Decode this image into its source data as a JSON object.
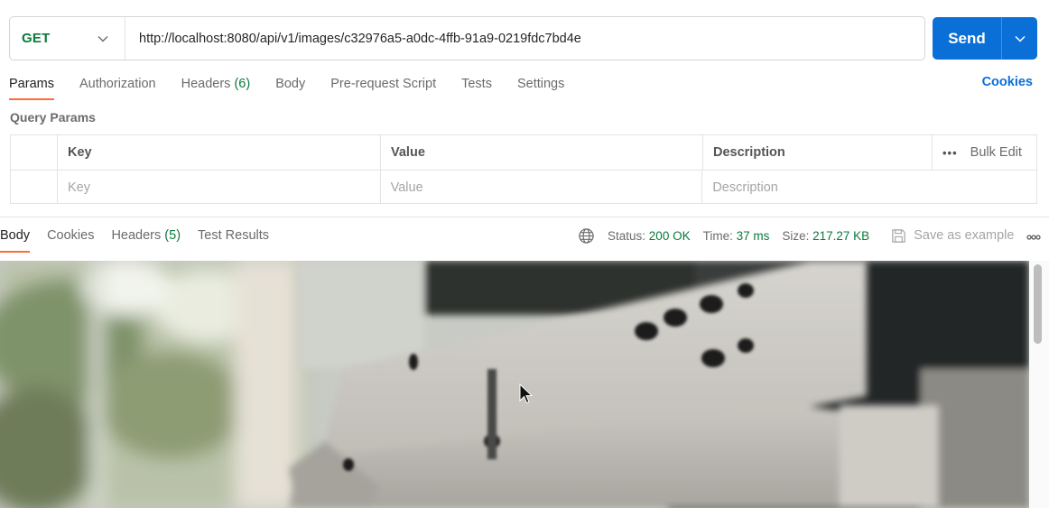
{
  "request": {
    "method": "GET",
    "url": "http://localhost:8080/api/v1/images/c32976a5-a0dc-4ffb-91a9-0219fdc7bd4e",
    "send_label": "Send"
  },
  "request_tabs": {
    "params": "Params",
    "authorization": "Authorization",
    "headers": "Headers",
    "headers_count": "(6)",
    "body": "Body",
    "prerequest": "Pre-request Script",
    "tests": "Tests",
    "settings": "Settings",
    "cookies": "Cookies"
  },
  "query_params": {
    "title": "Query Params",
    "columns": {
      "key": "Key",
      "value": "Value",
      "description": "Description"
    },
    "bulk_edit": "Bulk Edit",
    "placeholders": {
      "key": "Key",
      "value": "Value",
      "description": "Description"
    }
  },
  "response": {
    "tabs": {
      "body": "Body",
      "cookies": "Cookies",
      "headers": "Headers",
      "headers_count": "(5)",
      "test_results": "Test Results"
    },
    "status_label": "Status:",
    "status_value": "200 OK",
    "time_label": "Time:",
    "time_value": "37 ms",
    "size_label": "Size:",
    "size_value": "217.27 KB",
    "save_example": "Save as example"
  },
  "colors": {
    "accent": "#0b6fd8",
    "get_method": "#0a7a3b",
    "tab_underline": "#ff6c37"
  },
  "icons": [
    "chevron-down-icon",
    "globe-icon",
    "save-icon",
    "more-horizontal-icon",
    "cursor-icon"
  ]
}
